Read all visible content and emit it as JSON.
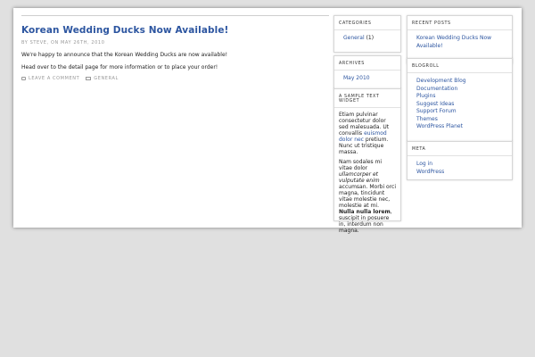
{
  "post": {
    "title": "Korean Wedding Ducks Now Available!",
    "meta": "By Steve, on May 26th, 2010",
    "paragraph1": "We're happy to announce that the Korean Wedding Ducks are now available!",
    "paragraph2": "Head over to the detail page for more information or to place your order!",
    "leave_comment": "Leave a comment",
    "category": "General"
  },
  "sidebar1": {
    "categories": {
      "title": "Categories",
      "item_label": "General",
      "item_count": "(1)"
    },
    "archives": {
      "title": "Archives",
      "items": [
        "May 2010"
      ]
    },
    "text_widget": {
      "title": "A Sample Text Widget",
      "p1_a": "Etiam pulvinar consectetur dolor sed malesuada. Ut convallis",
      "p1_link": "euismod dolor nec",
      "p1_b": "pretium. Nunc ut tristique massa.",
      "p2_a": "Nam sodales mi vitae dolor",
      "p2_em": "ullamcorper et vulputate enim",
      "p2_b": "accumsan. Morbi orci magna, tincidunt vitae molestie nec, molestie at mi.",
      "p2_strong": "Nulla nulla lorem",
      "p2_c": ", suscipit in posuere in, interdum non magna."
    }
  },
  "sidebar2": {
    "recent_posts": {
      "title": "Recent Posts",
      "items": [
        "Korean Wedding Ducks Now Available!"
      ]
    },
    "blogroll": {
      "title": "Blogroll",
      "items": [
        "Development Blog",
        "Documentation",
        "Plugins",
        "Suggest Ideas",
        "Support Forum",
        "Themes",
        "WordPress Planet"
      ]
    },
    "meta": {
      "title": "Meta",
      "items": [
        "Log in",
        "WordPress"
      ]
    }
  }
}
